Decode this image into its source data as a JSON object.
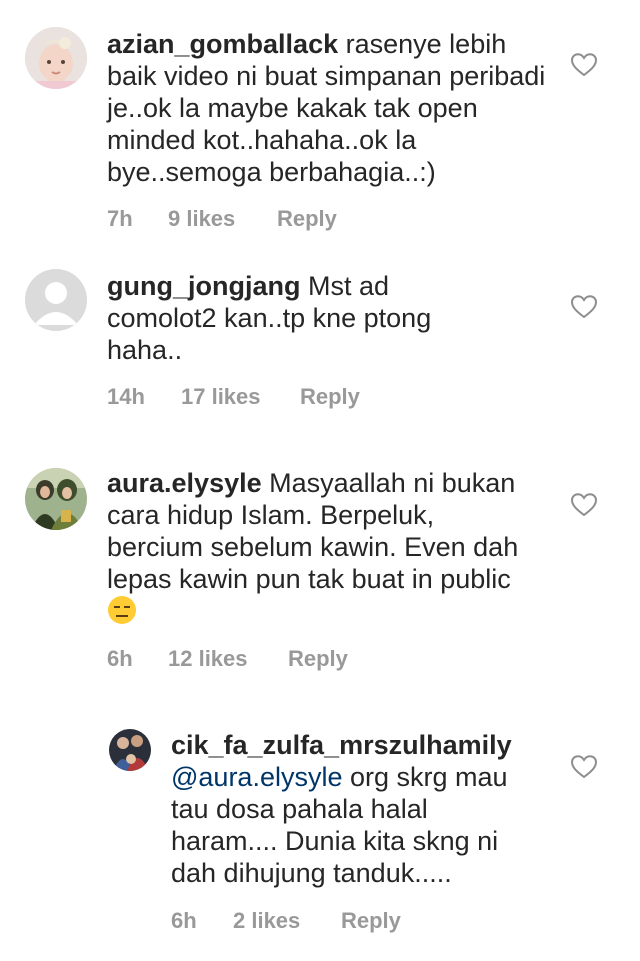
{
  "comments": [
    {
      "username": "azian_gomballack",
      "text": "rasenye lebih baik video ni buat simpanan peribadi je..ok la maybe kakak tak open minded kot..hahaha..ok la bye..semoga berbahagia..:)",
      "time": "7h",
      "likes": "9 likes",
      "reply": "Reply",
      "avatar_icon": "baby-photo-avatar"
    },
    {
      "username": "gung_jongjang",
      "text": "Mst ad comolot2 kan..tp kne ptong haha..",
      "time": "14h",
      "likes": "17 likes",
      "reply": "Reply",
      "avatar_icon": "default-user-avatar"
    },
    {
      "username": "aura.elysyle",
      "text": "Masyaallah ni bukan cara hidup Islam. Berpeluk, bercium sebelum kawin. Even dah lepas kawin pun tak buat in public",
      "emoji": "😑",
      "time": "6h",
      "likes": "12 likes",
      "reply": "Reply",
      "avatar_icon": "two-women-photo-avatar"
    },
    {
      "username": "cik_fa_zulfa_mrszulhamily",
      "mention": "@aura.elysyle",
      "text": "org skrg mau tau dosa pahala halal haram.... Dunia kita skng ni dah dihujung tanduk.....",
      "time": "6h",
      "likes": "2 likes",
      "reply": "Reply",
      "avatar_icon": "group-photo-avatar"
    }
  ],
  "colors": {
    "text": "#262626",
    "meta": "#999999",
    "mention": "#003569",
    "heart_stroke": "#8e8e8e"
  }
}
